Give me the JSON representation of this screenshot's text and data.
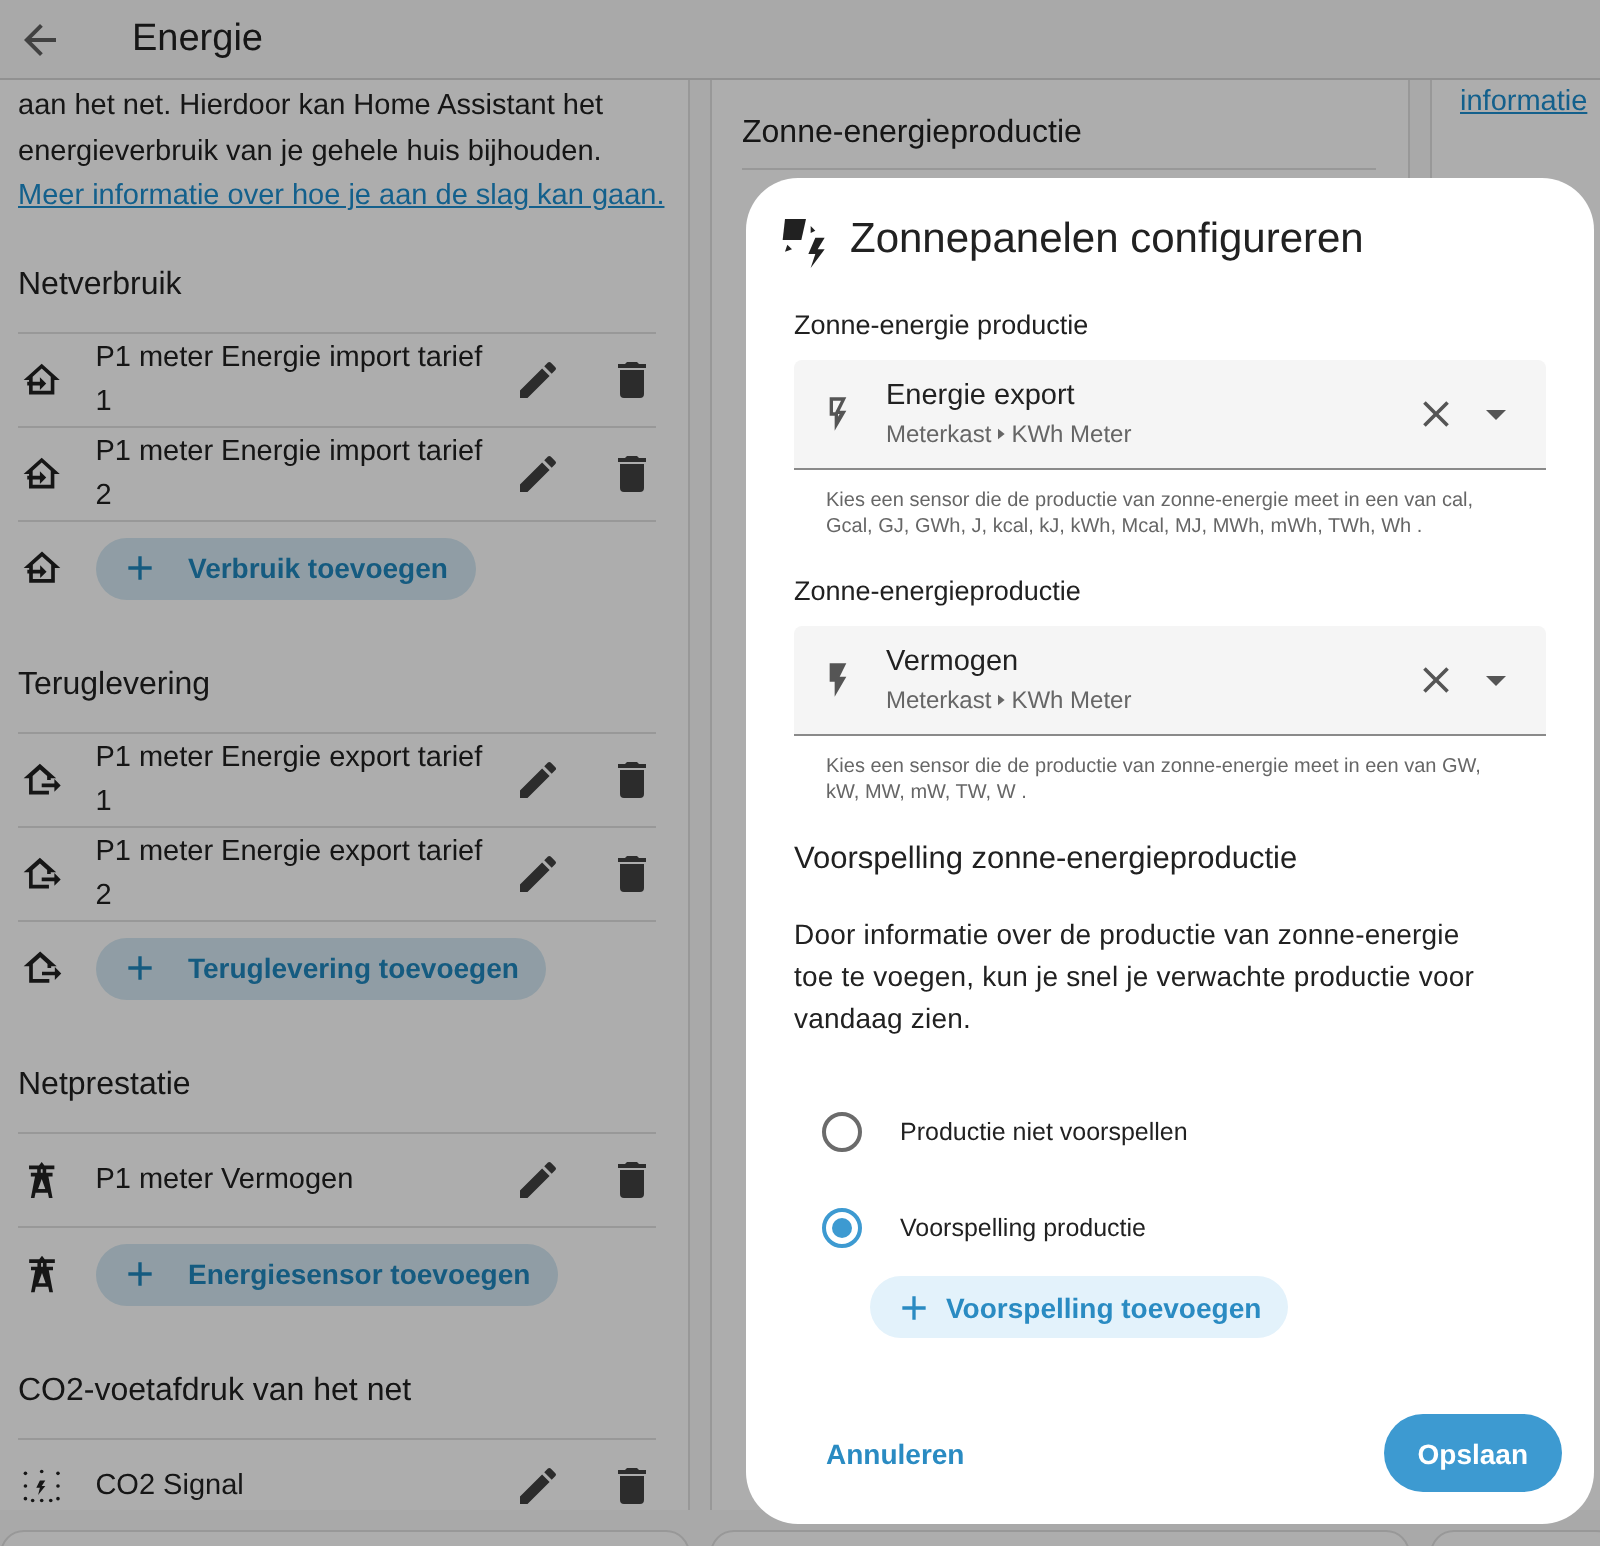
{
  "header": {
    "title": "Energie"
  },
  "grid_card": {
    "intro": "aan het net. Hierdoor kan Home Assistant het energieverbruik van je gehele huis bijhouden.",
    "link": "Meer informatie over hoe je aan de slag kan gaan.",
    "sections": [
      {
        "title": "Netverbruik",
        "kind": "import",
        "items": [
          {
            "label": "P1 meter Energie import tarief 1"
          },
          {
            "label": "P1 meter Energie import tarief 2"
          }
        ],
        "add_button": "Verbruik toevoegen"
      },
      {
        "title": "Teruglevering",
        "kind": "export",
        "items": [
          {
            "label": "P1 meter Energie export tarief 1"
          },
          {
            "label": "P1 meter Energie export tarief 2"
          }
        ],
        "add_button": "Teruglevering toevoegen"
      },
      {
        "title": "Netprestatie",
        "kind": "tower",
        "items": [
          {
            "label": "P1 meter Vermogen"
          }
        ],
        "add_button": "Energiesensor toevoegen"
      },
      {
        "title": "CO2-voetafdruk van het net",
        "kind": "co2",
        "items": [
          {
            "label": "CO2 Signal"
          }
        ]
      }
    ]
  },
  "solar_card": {
    "title": "Zonne-energieproductie"
  },
  "battery_card": {
    "link": "informatie"
  },
  "dialog": {
    "title": "Zonnepanelen configureren",
    "fields": [
      {
        "label": "Zonne-energie productie",
        "kind": "flash-outline",
        "value": "Energie export",
        "area": "Meterkast",
        "device": "KWh Meter",
        "helper": "Kies een sensor die de productie van zonne-energie meet in een van cal, Gcal, GJ, GWh, J, kcal, kJ, kWh, Mcal, MJ, MWh, mWh, TWh, Wh ."
      },
      {
        "label": "Zonne-energieproductie",
        "kind": "flash",
        "value": "Vermogen",
        "area": "Meterkast",
        "device": "KWh Meter",
        "helper": "Kies een sensor die de productie van zonne-energie meet in een van GW, kW, MW, mW, TW, W ."
      }
    ],
    "forecast_title": "Voorspelling zonne-energieproductie",
    "forecast_text": "Door informatie over de productie van zonne-energie toe te voegen, kun je snel je verwachte productie voor vandaag zien.",
    "options": [
      {
        "label": "Productie niet voorspellen",
        "selected": false
      },
      {
        "label": "Voorspelling productie",
        "selected": true
      }
    ],
    "add_forecast": "Voorspelling toevoegen",
    "cancel": "Annuleren",
    "save": "Opslaan"
  }
}
